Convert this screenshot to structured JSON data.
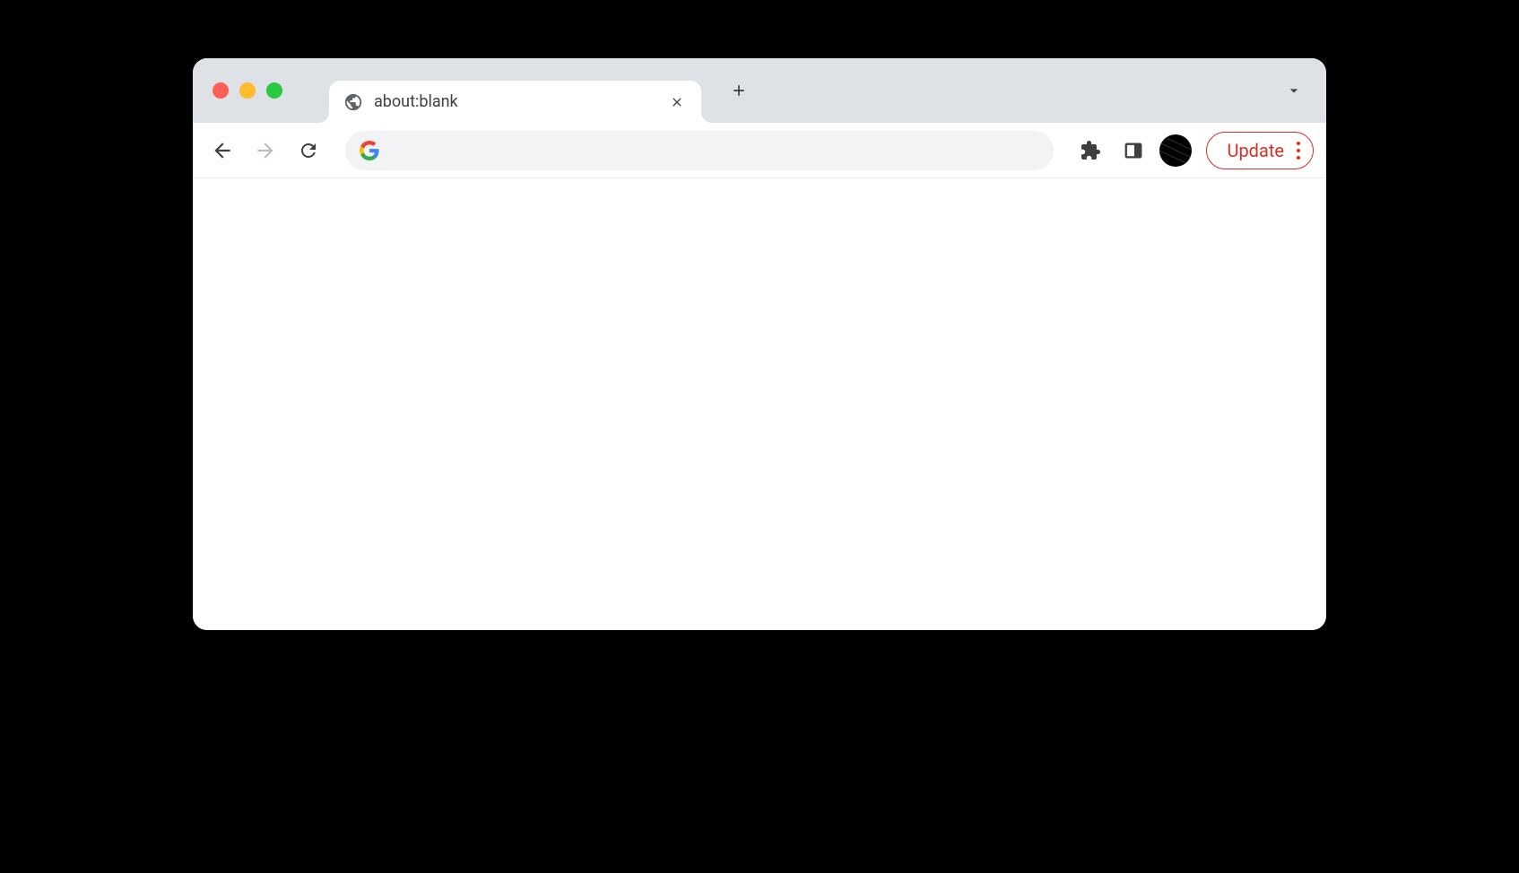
{
  "tab": {
    "title": "about:blank"
  },
  "address_bar": {
    "value": ""
  },
  "update_button": {
    "label": "Update"
  }
}
